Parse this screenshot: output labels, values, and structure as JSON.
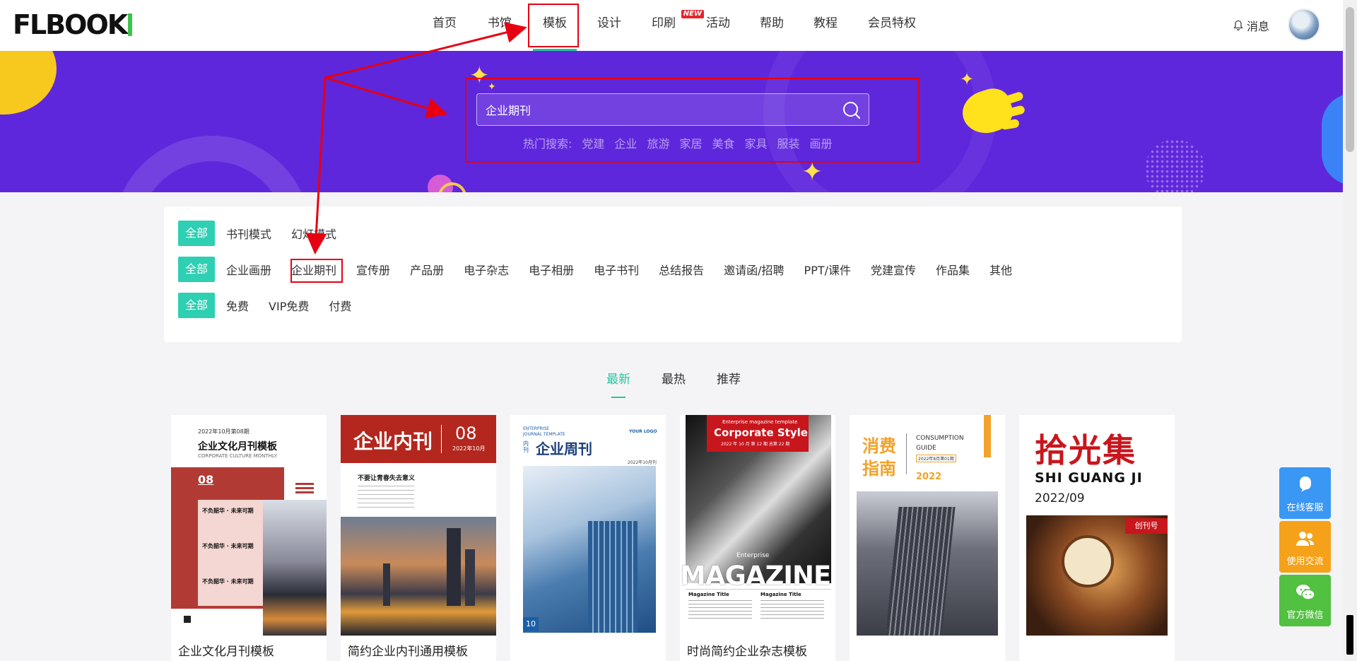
{
  "header": {
    "logo_text": "FLBOOK",
    "nav": [
      {
        "label": "首页"
      },
      {
        "label": "书馆"
      },
      {
        "label": "模板"
      },
      {
        "label": "设计"
      },
      {
        "label": "印刷"
      },
      {
        "label": "活动"
      },
      {
        "label": "帮助"
      },
      {
        "label": "教程"
      },
      {
        "label": "会员特权"
      }
    ],
    "nav_new_badge": "NEW",
    "message_label": "消息"
  },
  "banner": {
    "search_value": "企业期刊",
    "hot_label": "热门搜索:",
    "hot_terms": [
      "党建",
      "企业",
      "旅游",
      "家居",
      "美食",
      "家具",
      "服装",
      "画册"
    ]
  },
  "filters": {
    "row1": {
      "all": "全部",
      "options": [
        "书刊模式",
        "幻灯模式"
      ]
    },
    "row2": {
      "all": "全部",
      "options": [
        "企业画册",
        "企业期刊",
        "宣传册",
        "产品册",
        "电子杂志",
        "电子相册",
        "电子书刊",
        "总结报告",
        "邀请函/招聘",
        "PPT/课件",
        "党建宣传",
        "作品集",
        "其他"
      ]
    },
    "row3": {
      "all": "全部",
      "options": [
        "免费",
        "VIP免费",
        "付费"
      ]
    }
  },
  "sort_tabs": [
    "最新",
    "最热",
    "推荐"
  ],
  "cards": [
    {
      "title": "企业文化月刊模板",
      "cover": {
        "date": "2022年10月第08期",
        "heading": "企业文化月刊模板",
        "sub": "CORPORATE CULTURE MONTHLY",
        "num": "08",
        "line1": "不负韶华 · 未来可期",
        "line2": "不负韶华 · 未来可期",
        "line3": "不负韶华 · 未来可期"
      }
    },
    {
      "title": "简约企业内刊通用模板",
      "cover": {
        "heading": "企业内刊",
        "num": "08",
        "date": "2022年10月",
        "line": "不要让青春失去意义"
      }
    },
    {
      "title": "",
      "cover": {
        "top1": "ENTERPRISE",
        "top2": "JOURNAL TEMPLATE",
        "logo": "YOUR LOGO",
        "tag": "内刊",
        "heading": "企业周刊",
        "date": "2022年10月刊",
        "num": "10",
        "quote": "“"
      }
    },
    {
      "title": "时尚简约企业杂志模板",
      "cover": {
        "top": "Enterprise magazine template",
        "heading": "Corporate Style",
        "date": "2022 年 10 月 第 12 期 总第 22 期",
        "mid": "Enterprise",
        "big": "MAGAZINE",
        "col1": "Magazine Title",
        "col2": "Magazine Title"
      }
    },
    {
      "title": "",
      "cover": {
        "h1": "消费",
        "h2": "指南",
        "en1": "CONSUMPTION",
        "en2": "GUIDE",
        "date": "2022年8月第01期",
        "year": "2022"
      }
    },
    {
      "title": "",
      "cover": {
        "h": "拾光集",
        "en": "SHI GUANG JI",
        "date": "2022/09",
        "badge": "创刊号"
      }
    }
  ],
  "float_buttons": [
    "在线客服",
    "使用交流",
    "官方微信"
  ],
  "colors": {
    "accent": "#26c6a0",
    "banner": "#5f27dc",
    "annotation": "#e60012"
  }
}
